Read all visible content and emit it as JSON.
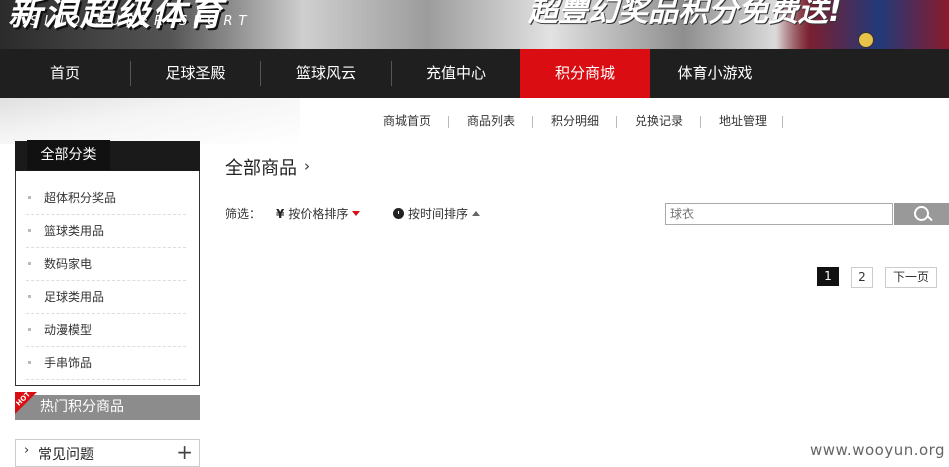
{
  "banner": {
    "logo_text": "新浪超级体育",
    "logo_sub": "SINO SUPER SPORT",
    "slogan": "超豐幻奖品积分免费送!"
  },
  "nav": {
    "items": [
      {
        "label": "首页"
      },
      {
        "label": "足球圣殿"
      },
      {
        "label": "篮球风云"
      },
      {
        "label": "充值中心"
      },
      {
        "label": "积分商城"
      },
      {
        "label": "体育小游戏"
      }
    ],
    "active": "积分商城",
    "active_color": "#d90d12"
  },
  "subnav": {
    "links": [
      "商城首页",
      "商品列表",
      "积分明细",
      "兑换记录",
      "地址管理"
    ]
  },
  "sidebar": {
    "category_title": "全部分类",
    "categories": [
      "超体积分奖品",
      "篮球类用品",
      "数码家电",
      "足球类用品",
      "动漫模型",
      "手串饰品"
    ],
    "hot_tag": "HOT",
    "hot_title": "热门积分商品",
    "faq_title": "常见问题"
  },
  "main": {
    "title": "全部商品",
    "filter_label": "筛选：",
    "sort_price": "按价格排序",
    "sort_time": "按时间排序",
    "search_placeholder": "球衣",
    "pagination": {
      "pages": [
        "1",
        "2"
      ],
      "current": "1",
      "next": "下一页"
    }
  },
  "watermark": "www.wooyun.org"
}
